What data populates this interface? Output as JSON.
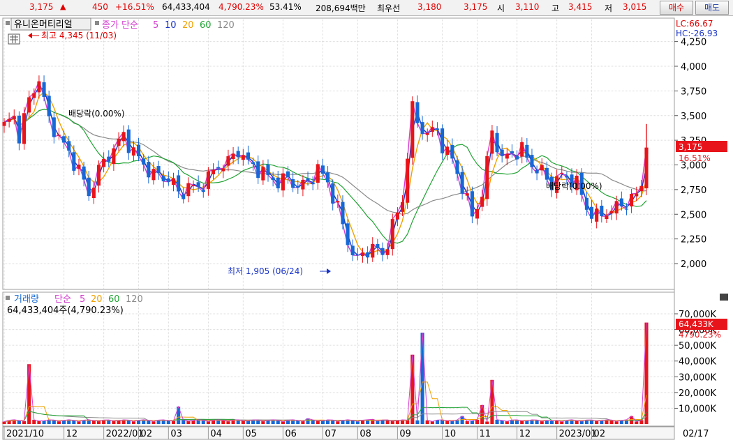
{
  "top_bar": {
    "price": "3,175",
    "up_arrow": "▲",
    "change": "450",
    "change_pct": "+16.51%",
    "volume": "64,433,404",
    "volume_ratio": "4,790.23%",
    "turnover": "53.41%",
    "amount": "208,694백만",
    "best_bid_label": "최우선",
    "best_ask": "3,180",
    "best_bid": "3,175",
    "open_label": "시",
    "open": "3,110",
    "high_label": "고",
    "high": "3,415",
    "low_label": "저",
    "low": "3,015",
    "buy_button": "매수",
    "sell_button": "매도"
  },
  "colors": {
    "up": "#e8141b",
    "down": "#1668d6",
    "ma5": "#d43fd0",
    "ma10": "#1a34c8",
    "ma20": "#f0a100",
    "ma60": "#1fa332",
    "ma120": "#8a8a8a",
    "grid": "#dcdcdc"
  },
  "price_panel": {
    "stock_name": "유니온머티리얼",
    "legend_title": "종가 단순",
    "ma_labels": [
      "5",
      "10",
      "20",
      "60",
      "120"
    ],
    "lc": "LC:66.67",
    "hc": "HC:-26.93",
    "high_marker": "최고 4,345 (11/03)",
    "low_marker": "최저 1,905 (06/24)",
    "ex_dividend_1": "배당락(0.00%)",
    "ex_dividend_2": "배당락(0.00%)",
    "current_price_tag": "3,175",
    "current_pct_tag": "16.51%"
  },
  "volume_panel": {
    "title": "거래량",
    "legend_title": "단순",
    "ma_labels": [
      "5",
      "20",
      "60",
      "120"
    ],
    "volume_text": "64,433,404주(4,790.23%)",
    "current_volume_tag": "64,433K",
    "current_pct_tag": "4790.23%"
  },
  "chart_data": [
    {
      "type": "candlestick",
      "title": "유니온머티리얼",
      "ylim": [
        1800,
        4300
      ],
      "y_ticks": [
        "4,250",
        "4,000",
        "3,750",
        "3,500",
        "3,250",
        "3,000",
        "2,750",
        "2,500",
        "2,250",
        "2,000"
      ],
      "x_ticks": [
        "2021/10",
        "12",
        "2022/01",
        "02",
        "03",
        "04",
        "05",
        "06",
        "07",
        "08",
        "09",
        "10",
        "11",
        "12",
        "2023/01",
        "02"
      ],
      "close_series": [
        [
          0,
          3400
        ],
        [
          2,
          3480
        ],
        [
          3,
          3300
        ],
        [
          5,
          3650
        ],
        [
          7,
          3880
        ],
        [
          8,
          3650
        ],
        [
          9,
          3450
        ],
        [
          12,
          3200
        ],
        [
          15,
          2950
        ],
        [
          17,
          2700
        ],
        [
          19,
          2950
        ],
        [
          21,
          3100
        ],
        [
          24,
          3300
        ],
        [
          26,
          3130
        ],
        [
          28,
          3000
        ],
        [
          30,
          2900
        ],
        [
          32,
          2880
        ],
        [
          34,
          2820
        ],
        [
          35,
          2700
        ],
        [
          37,
          2780
        ],
        [
          39,
          2760
        ],
        [
          41,
          2870
        ],
        [
          43,
          2990
        ],
        [
          45,
          3030
        ],
        [
          47,
          3150
        ],
        [
          49,
          3020
        ],
        [
          51,
          2960
        ],
        [
          53,
          2880
        ],
        [
          55,
          2830
        ],
        [
          57,
          2860
        ],
        [
          59,
          2780
        ],
        [
          61,
          2820
        ],
        [
          63,
          2960
        ],
        [
          65,
          2820
        ],
        [
          67,
          2560
        ],
        [
          69,
          2220
        ],
        [
          71,
          2020
        ],
        [
          72,
          2100
        ],
        [
          74,
          2170
        ],
        [
          76,
          2080
        ],
        [
          78,
          2380
        ],
        [
          80,
          2640
        ],
        [
          81,
          3120
        ],
        [
          82,
          3570
        ],
        [
          83,
          3420
        ],
        [
          85,
          3320
        ],
        [
          87,
          3350
        ],
        [
          88,
          3200
        ],
        [
          90,
          3050
        ],
        [
          92,
          2780
        ],
        [
          94,
          2480
        ],
        [
          96,
          2700
        ],
        [
          98,
          3350
        ],
        [
          100,
          3050
        ],
        [
          102,
          3120
        ],
        [
          104,
          3150
        ],
        [
          106,
          3000
        ],
        [
          108,
          2920
        ],
        [
          110,
          2800
        ],
        [
          111,
          2870
        ],
        [
          113,
          2880
        ],
        [
          115,
          2820
        ],
        [
          117,
          2560
        ],
        [
          119,
          2470
        ],
        [
          121,
          2520
        ],
        [
          123,
          2570
        ],
        [
          125,
          2620
        ],
        [
          127,
          2690
        ],
        [
          128,
          2800
        ],
        [
          129,
          3175
        ]
      ],
      "close_series_note": "x is the trading-week index from 2021/10 (0) to 2023/02 (129)",
      "markers": {
        "high": {
          "value": 4345,
          "date": "11/03"
        },
        "low": {
          "value": 1905,
          "date": "06/24"
        }
      },
      "current": {
        "price": 3175,
        "change_pct": 16.51
      },
      "moving_averages": [
        "5",
        "10",
        "20",
        "60",
        "120"
      ],
      "legend": "top-left"
    },
    {
      "type": "bar",
      "title": "거래량",
      "ylim": [
        0,
        80000
      ],
      "y_ticks": [
        "70,000K",
        "60,000K",
        "50,000K",
        "40,000K",
        "30,000K",
        "20,000K",
        "10,000K"
      ],
      "volume_spikes_k": [
        [
          5,
          38000
        ],
        [
          35,
          11000
        ],
        [
          61,
          3500
        ],
        [
          74,
          3000
        ],
        [
          82,
          44000
        ],
        [
          84,
          58000
        ],
        [
          92,
          5000
        ],
        [
          96,
          12000
        ],
        [
          98,
          28000
        ],
        [
          110,
          2000
        ],
        [
          126,
          5000
        ],
        [
          129,
          64433
        ]
      ],
      "baseline_k": 1500,
      "current_volume": "64,433,404",
      "current_pct": 4790.23
    }
  ],
  "x_axis": {
    "labels": [
      "2021/10",
      "12",
      "2022/01",
      "02",
      "03",
      "04",
      "05",
      "06",
      "07",
      "08",
      "09",
      "10",
      "11",
      "12",
      "2023/01",
      "02"
    ],
    "right_label": "02/17"
  }
}
